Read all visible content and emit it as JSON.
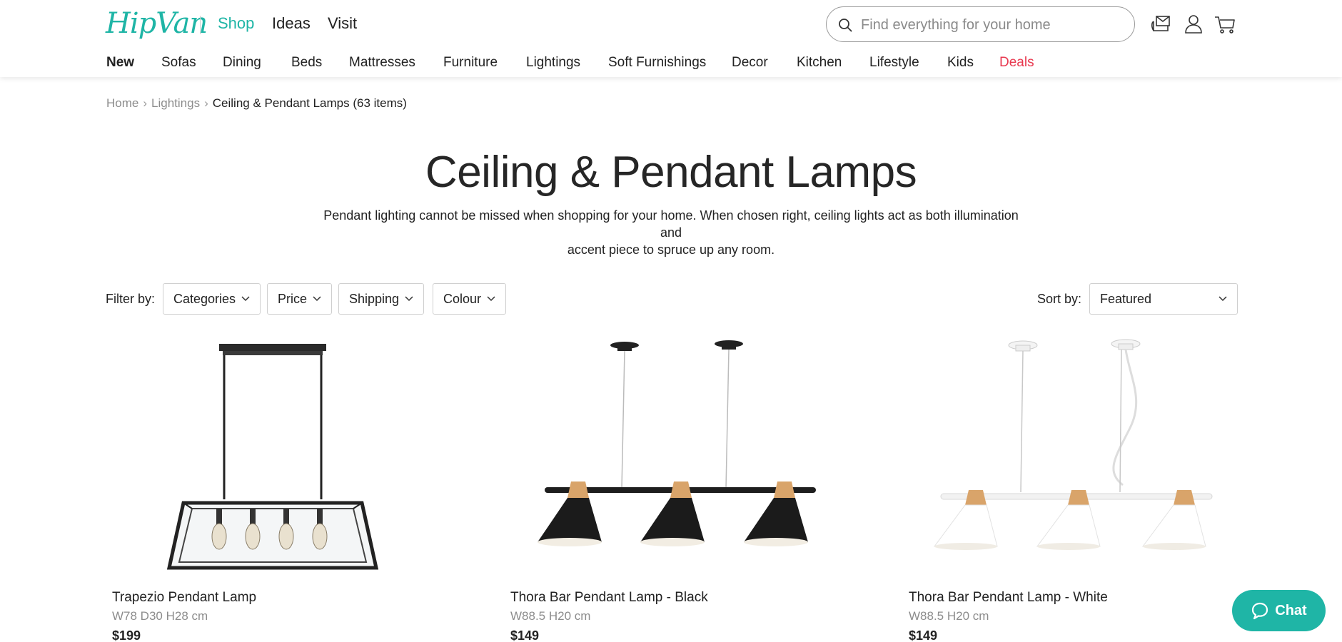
{
  "brand": {
    "logo_text": "HipVan",
    "accent": "#1fb5a6",
    "deals_color": "#e8384f"
  },
  "top_nav": {
    "shop": "Shop",
    "ideas": "Ideas",
    "visit": "Visit"
  },
  "search": {
    "placeholder": "Find everything for your home",
    "value": ""
  },
  "header_icons": [
    "messages-icon",
    "user-icon",
    "cart-icon"
  ],
  "categories": [
    "New",
    "Sofas",
    "Dining",
    "Beds",
    "Mattresses",
    "Furniture",
    "Lightings",
    "Soft Furnishings",
    "Decor",
    "Kitchen",
    "Lifestyle",
    "Kids",
    "Deals"
  ],
  "breadcrumb": {
    "home": "Home",
    "lightings": "Lightings",
    "current": "Ceiling & Pendant Lamps (63 items)"
  },
  "page": {
    "title": "Ceiling & Pendant Lamps",
    "description_line1": "Pendant lighting cannot be missed when shopping for your home. When chosen right, ceiling lights act as both illumination and",
    "description_line2": "accent piece to spruce up any room."
  },
  "filters": {
    "label": "Filter by:",
    "categories": "Categories",
    "price": "Price",
    "shipping": "Shipping",
    "colour": "Colour"
  },
  "sort": {
    "label": "Sort by:",
    "selected": "Featured"
  },
  "products": [
    {
      "name": "Trapezio Pendant Lamp",
      "dimensions": "W78 D30 H28 cm",
      "price": "$199"
    },
    {
      "name": "Thora Bar Pendant Lamp - Black",
      "dimensions": "W88.5 H20 cm",
      "price": "$149"
    },
    {
      "name": "Thora Bar Pendant Lamp - White",
      "dimensions": "W88.5 H20 cm",
      "price": "$149"
    }
  ],
  "chat": {
    "label": "Chat"
  }
}
